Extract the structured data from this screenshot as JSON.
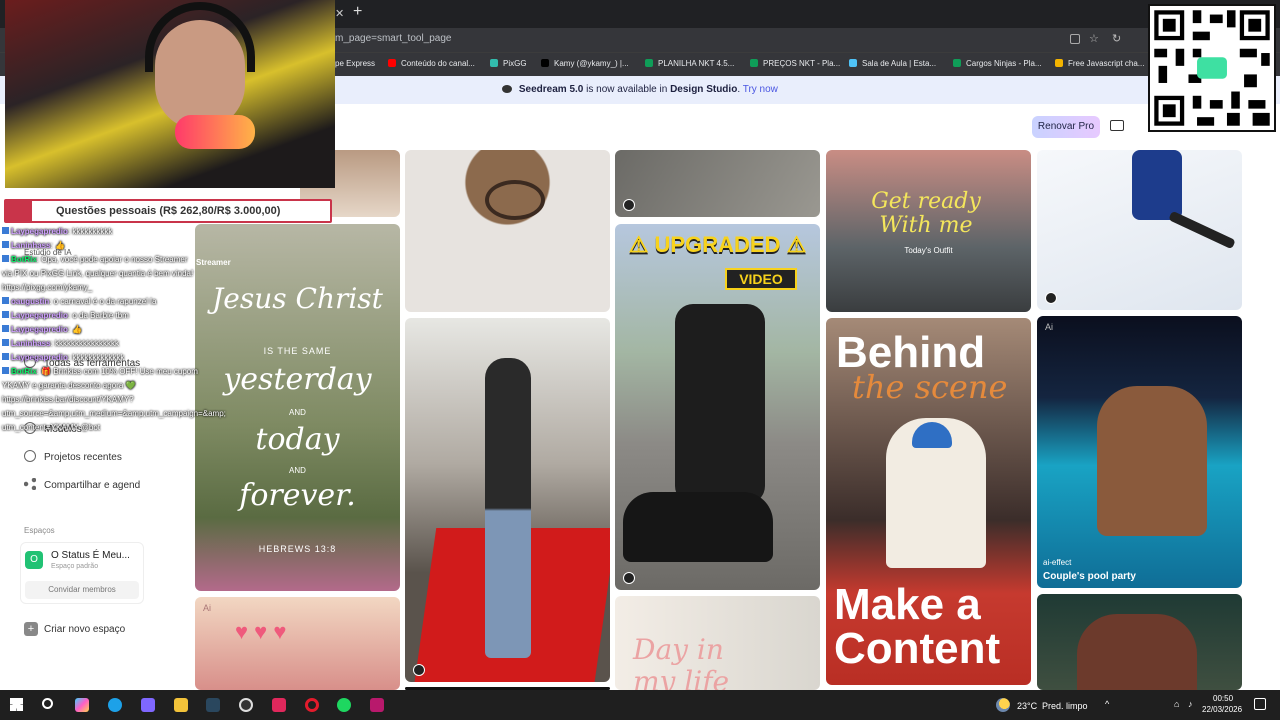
{
  "browser": {
    "url": "m_page=smart_tool_page",
    "bookmarks": [
      {
        "label": "pe Express",
        "color": "#bbbbbb"
      },
      {
        "label": "Conteúdo do canal...",
        "color": "#ff0000"
      },
      {
        "label": "PixGG",
        "color": "#32bcad"
      },
      {
        "label": "Kamy (@ykamy_) |...",
        "color": "#000000"
      },
      {
        "label": "PLANILHA NKT 4.5...",
        "color": "#0f9d58"
      },
      {
        "label": "PREÇOS NKT - Pla...",
        "color": "#0f9d58"
      },
      {
        "label": "Sala de Aula | Esta...",
        "color": "#4fc3f7"
      },
      {
        "label": "Cargos Ninjas - Pla...",
        "color": "#0f9d58"
      },
      {
        "label": "Free Javascript cha...",
        "color": "#f4b400"
      }
    ]
  },
  "banner": {
    "product": "Seedream 5.0",
    "middle": " is now available in ",
    "place": "Design Studio",
    "link": "Try now"
  },
  "header": {
    "renovar_label": "Renovar Pro"
  },
  "sidebar": {
    "items": [
      "Estúdio de IA",
      "Streamer",
      "Todas as ferramentas",
      "Modelos",
      "Projetos recentes",
      "Compartilhar e agend"
    ],
    "espacos_heading": "Espaços",
    "space": {
      "icon_letter": "O",
      "name": "O Status É Meu...",
      "sub": "Espaço padrão",
      "invite": "Convidar membros"
    },
    "new_space": "Criar novo espaço"
  },
  "gallery": {
    "jesus": {
      "title": "Jesus Christ",
      "l1": "IS THE SAME",
      "l2": "yesterday",
      "l3": "AND",
      "l4": "today",
      "l5": "AND",
      "l6": "forever.",
      "ref": "HEBREWS 13:8"
    },
    "upgraded": {
      "title": "UPGRADED",
      "video": "VIDEO"
    },
    "outfit": {
      "title": "Get ready With me",
      "sub": "Today's Outfit"
    },
    "behind": {
      "l1": "Behind",
      "l2": "the scene",
      "l3": "Make a",
      "l4": "Content"
    },
    "pool": {
      "tag": "ai-effect",
      "title": "Couple's pool party",
      "ai": "Ai"
    },
    "dayin": {
      "title": "Day in my life"
    },
    "ai_badge": "Ai"
  },
  "overlay": {
    "goal": "Questões pessoais (R$ 262,80/R$ 3.000,00)",
    "chat": [
      {
        "user": "Laypegapredio",
        "msg": ": kkkkkkkkkk"
      },
      {
        "user": "Laninhass",
        "msg": ": 👍"
      },
      {
        "user": "BotRix",
        "msg": ": Opa, você pode apoiar o nosso Streamer"
      },
      {
        "user": "",
        "msg": "via PIX ou PixGG Link, qualquer quantia é bem vinda!"
      },
      {
        "user": "",
        "msg": "https://pixgg.com/ykamy_"
      },
      {
        "user": "oaugustin",
        "msg": ": o carnaval é o da rapunzel la"
      },
      {
        "user": "Laypegapredio",
        "msg": ": o da Barbie tbm"
      },
      {
        "user": "Laypegapredio",
        "msg": ": 👍"
      },
      {
        "user": "Laninhass",
        "msg": ": kkkkkkkkkkkkkkkk"
      },
      {
        "user": "Laypegapredio",
        "msg": ": kkkkkkkkkkkkk"
      },
      {
        "user": "BotRix",
        "msg": ": 🎁 Brinkiss com 10% OFF! Use meu cupom"
      },
      {
        "user": "",
        "msg": "YKAMY e garanta desconto agora 💚"
      },
      {
        "user": "",
        "msg": "https://brinkiss.bar/discount/YKAMY?"
      },
      {
        "user": "",
        "msg": "utm_source=&amp;utm_medium=&amp;utm_campaign=&amp;"
      },
      {
        "user": "",
        "msg": "utm_content=YKAMY @bot"
      }
    ]
  },
  "taskbar": {
    "temp": "23°C",
    "weather": "Pred. limpo",
    "time": "00:50",
    "date": "22/03/2026"
  }
}
